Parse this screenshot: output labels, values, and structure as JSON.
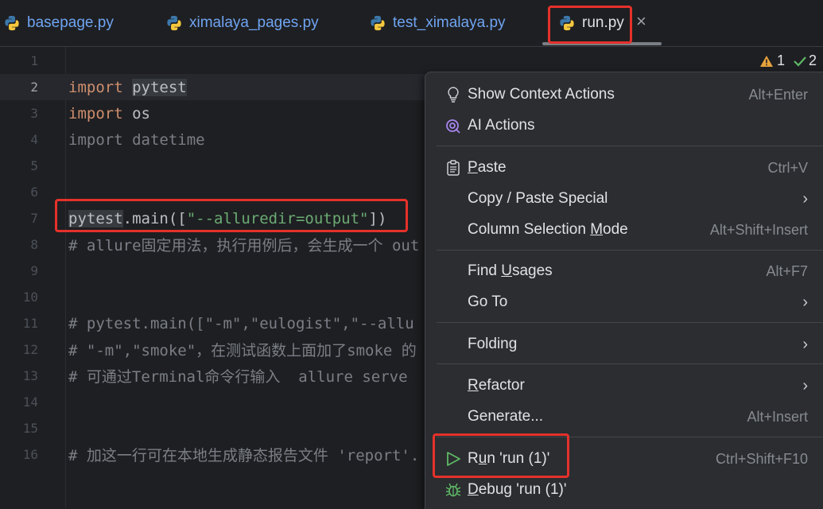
{
  "tabs": [
    {
      "label": "basepage.py"
    },
    {
      "label": "ximalaya_pages.py"
    },
    {
      "label": "test_ximalaya.py"
    },
    {
      "label": "run.py",
      "active": true
    }
  ],
  "inspections": {
    "warnings": "1",
    "ok": "2"
  },
  "editor": {
    "lines": [
      {
        "n": "1",
        "text": ""
      },
      {
        "n": "2",
        "text": ""
      },
      {
        "n": "3",
        "text": ""
      },
      {
        "n": "4",
        "text": ""
      },
      {
        "n": "5",
        "text": ""
      },
      {
        "n": "6",
        "text": ""
      },
      {
        "n": "7",
        "text": ""
      },
      {
        "n": "8",
        "text": "# allure固定用法，执行用例后，会生成一个 out"
      },
      {
        "n": "9",
        "text": ""
      },
      {
        "n": "10",
        "text": ""
      },
      {
        "n": "11",
        "text": "# pytest.main([\"-m\",\"eulogist\",\"--allu"
      },
      {
        "n": "12",
        "text": "# \"-m\",\"smoke\"，在测试函数上面加了smoke 的"
      },
      {
        "n": "13",
        "text": "# 可通过Terminal命令行输入  allure serve"
      },
      {
        "n": "14",
        "text": ""
      },
      {
        "n": "15",
        "text": ""
      },
      {
        "n": "16",
        "text": "# 加这一行可在本地生成静态报告文件 'report'."
      }
    ],
    "kw_import": "import",
    "mod_pytest": "pytest",
    "mod_os": "os",
    "line4": "import datetime",
    "main_prefix": "pytest",
    "main_call": ".main([",
    "main_arg": "\"--alluredir=output\"",
    "main_close": "])"
  },
  "context_menu": {
    "items": [
      {
        "label": "Show Context Actions",
        "shortcut": "Alt+Enter",
        "icon": "lightbulb-icon"
      },
      {
        "label": "AI Actions",
        "icon": "ai-icon"
      },
      {
        "label_pre": "",
        "mnemonic": "P",
        "label_post": "aste",
        "shortcut": "Ctrl+V",
        "icon": "clipboard-icon"
      },
      {
        "label": "Copy / Paste Special",
        "submenu": true
      },
      {
        "label_pre": "Column Selection ",
        "mnemonic": "M",
        "label_post": "ode",
        "shortcut": "Alt+Shift+Insert"
      },
      {
        "label_pre": "Find ",
        "mnemonic": "U",
        "label_post": "sages",
        "shortcut": "Alt+F7"
      },
      {
        "label": "Go To",
        "submenu": true
      },
      {
        "label": "Folding",
        "submenu": true
      },
      {
        "label_pre": "",
        "mnemonic": "R",
        "label_post": "efactor",
        "submenu": true
      },
      {
        "label": "Generate...",
        "shortcut": "Alt+Insert"
      },
      {
        "label_pre": "R",
        "mnemonic": "u",
        "label_post": "n 'run (1)'",
        "shortcut": "Ctrl+Shift+F10",
        "icon": "run-icon"
      },
      {
        "label_pre": "",
        "mnemonic": "D",
        "label_post": "ebug 'run (1)'",
        "icon": "debug-icon"
      }
    ],
    "submenu_arrow": "›"
  },
  "colors": {
    "highlight_box": "#e5312b",
    "accent": "#6fa4f2"
  }
}
